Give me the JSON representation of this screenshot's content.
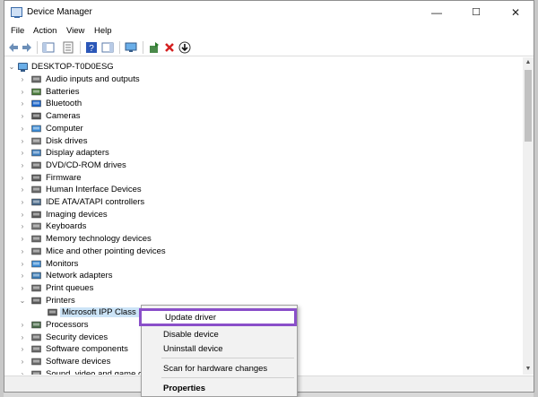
{
  "window": {
    "title": "Device Manager",
    "minimize": "—",
    "maximize": "☐",
    "close": "✕"
  },
  "menu": [
    "File",
    "Action",
    "View",
    "Help"
  ],
  "toolbar": {
    "icons": [
      "back-arrow-icon",
      "forward-arrow-icon",
      "show-hide-console-tree-icon",
      "properties-icon",
      "help-icon",
      "action-pane-icon",
      "monitor-icon",
      "update-driver-icon",
      "uninstall-device-icon",
      "scan-hardware-icon"
    ]
  },
  "tree": {
    "root": "DESKTOP-T0D0ESG",
    "items": [
      {
        "label": "Audio inputs and outputs",
        "icon": "speaker-icon",
        "color": "#6a6a6a"
      },
      {
        "label": "Batteries",
        "icon": "battery-icon",
        "color": "#4a7a3a"
      },
      {
        "label": "Bluetooth",
        "icon": "bluetooth-icon",
        "color": "#1a66cc"
      },
      {
        "label": "Cameras",
        "icon": "camera-icon",
        "color": "#555555"
      },
      {
        "label": "Computer",
        "icon": "computer-icon",
        "color": "#3a8ad4"
      },
      {
        "label": "Disk drives",
        "icon": "disk-drive-icon",
        "color": "#777777"
      },
      {
        "label": "Display adapters",
        "icon": "display-adapter-icon",
        "color": "#3f7fbf"
      },
      {
        "label": "DVD/CD-ROM drives",
        "icon": "dvd-drive-icon",
        "color": "#666666"
      },
      {
        "label": "Firmware",
        "icon": "firmware-icon",
        "color": "#5a5a5a"
      },
      {
        "label": "Human Interface Devices",
        "icon": "hid-icon",
        "color": "#6a6a6a"
      },
      {
        "label": "IDE ATA/ATAPI controllers",
        "icon": "ide-controller-icon",
        "color": "#4a6a8a"
      },
      {
        "label": "Imaging devices",
        "icon": "imaging-device-icon",
        "color": "#5a5a5a"
      },
      {
        "label": "Keyboards",
        "icon": "keyboard-icon",
        "color": "#777777"
      },
      {
        "label": "Memory technology devices",
        "icon": "memory-device-icon",
        "color": "#6a6a6a"
      },
      {
        "label": "Mice and other pointing devices",
        "icon": "mouse-icon",
        "color": "#6a6a6a"
      },
      {
        "label": "Monitors",
        "icon": "monitor-icon",
        "color": "#3a8ad4"
      },
      {
        "label": "Network adapters",
        "icon": "network-adapter-icon",
        "color": "#3a7ab4"
      },
      {
        "label": "Print queues",
        "icon": "print-queue-icon",
        "color": "#6a6a6a"
      },
      {
        "label": "Printers",
        "icon": "printer-icon",
        "color": "#5a5a5a",
        "expanded": true
      },
      {
        "label": "Microsoft IPP Class Dri",
        "icon": "printer-icon",
        "color": "#5a5a5a",
        "child": true,
        "selected": true
      },
      {
        "label": "Processors",
        "icon": "processor-icon",
        "color": "#4a6a4a"
      },
      {
        "label": "Security devices",
        "icon": "security-device-icon",
        "color": "#6a6a6a"
      },
      {
        "label": "Software components",
        "icon": "software-component-icon",
        "color": "#6a6a6a"
      },
      {
        "label": "Software devices",
        "icon": "software-device-icon",
        "color": "#6a6a6a"
      },
      {
        "label": "Sound, video and game co",
        "icon": "sound-icon",
        "color": "#6a6a6a"
      }
    ]
  },
  "context_menu": {
    "items": [
      "Update driver",
      "Disable device",
      "Uninstall device",
      "Scan for hardware changes",
      "Properties"
    ],
    "highlight_color": "#8a4fc9"
  }
}
